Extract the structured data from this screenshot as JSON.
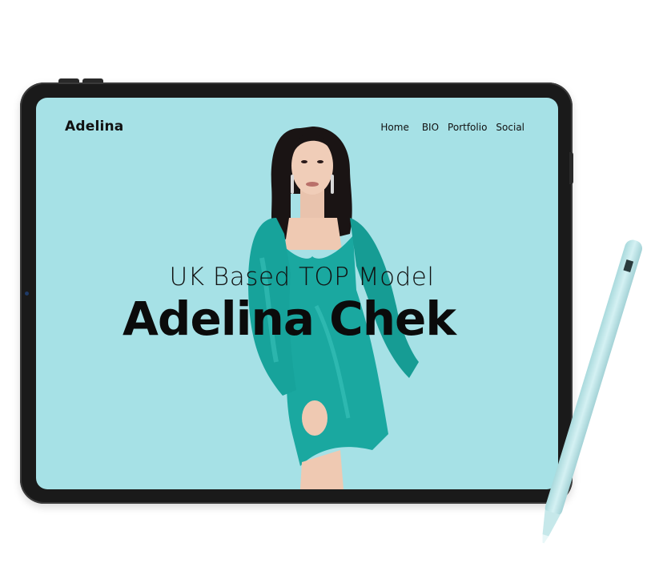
{
  "site": {
    "logo": "Adelina",
    "nav": {
      "items": [
        "Home",
        "BIO",
        "Portfolio",
        "Social"
      ]
    },
    "hero": {
      "subtitle": "UK Based TOP Model",
      "headline": "Adelina Chek"
    }
  },
  "colors": {
    "screen_bg": "#a6e1e6",
    "dress": "#1aa8a0",
    "pencil": "#c9ecef",
    "tablet_frame": "#1a1a1a"
  },
  "icons": {
    "camera": "front-camera-dot",
    "pencil": "stylus-pencil"
  }
}
